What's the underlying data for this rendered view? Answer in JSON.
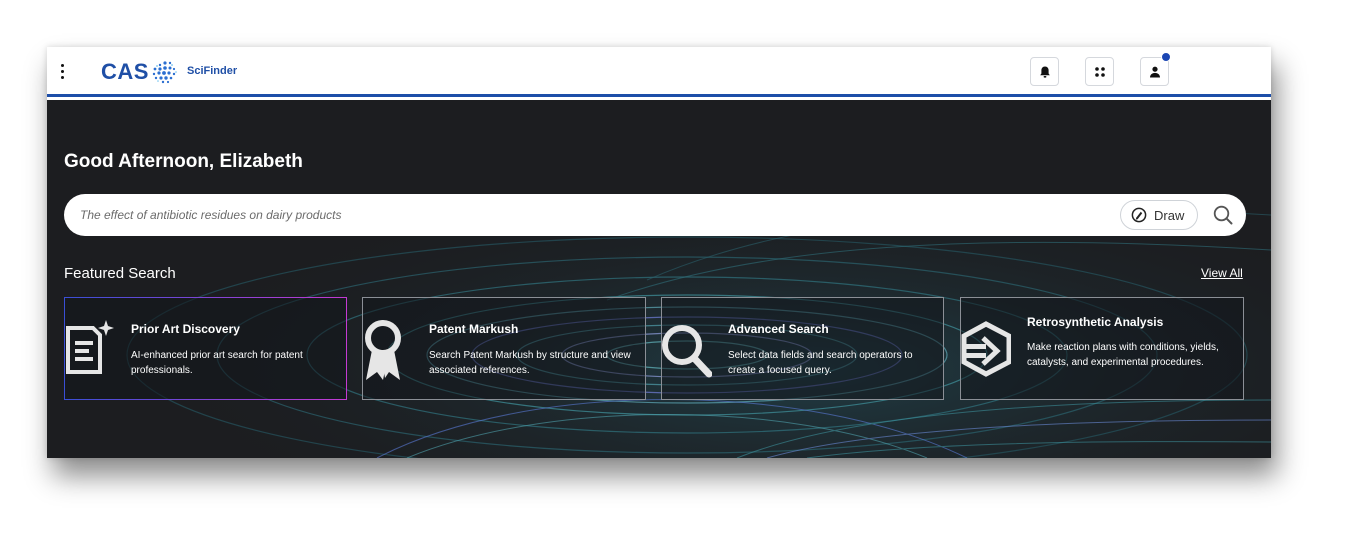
{
  "brand": {
    "cas": "CAS",
    "product": "SciFinder"
  },
  "header": {
    "menu_icon": "kebab-menu-icon",
    "notifications_icon": "bell-icon",
    "apps_icon": "apps-grid-icon",
    "user_icon": "user-icon",
    "notification_dot_color": "#1b46b3",
    "accent_color": "#1d4ea8"
  },
  "hero": {
    "greeting": "Good Afternoon, Elizabeth",
    "search": {
      "placeholder": "The effect of antibiotic residues on dairy products",
      "draw_label": "Draw",
      "draw_icon": "draw-structure-icon",
      "search_icon": "search-icon"
    },
    "featured_title": "Featured Search",
    "view_all": "View All",
    "cards": [
      {
        "title": "Prior Art Discovery",
        "description": "AI-enhanced prior art search for patent professionals.",
        "icon": "document-sparkle-icon"
      },
      {
        "title": "Patent Markush",
        "description": "Search Patent Markush by structure and view associated references.",
        "icon": "award-ribbon-icon"
      },
      {
        "title": "Advanced Search",
        "description": "Select data fields and search operators to create a focused query.",
        "icon": "magnifier-icon"
      },
      {
        "title": "Retrosynthetic Analysis",
        "description": "Make reaction plans with conditions, yields, catalysts, and experimental procedures.",
        "icon": "retrosynthesis-arrow-icon"
      }
    ]
  }
}
